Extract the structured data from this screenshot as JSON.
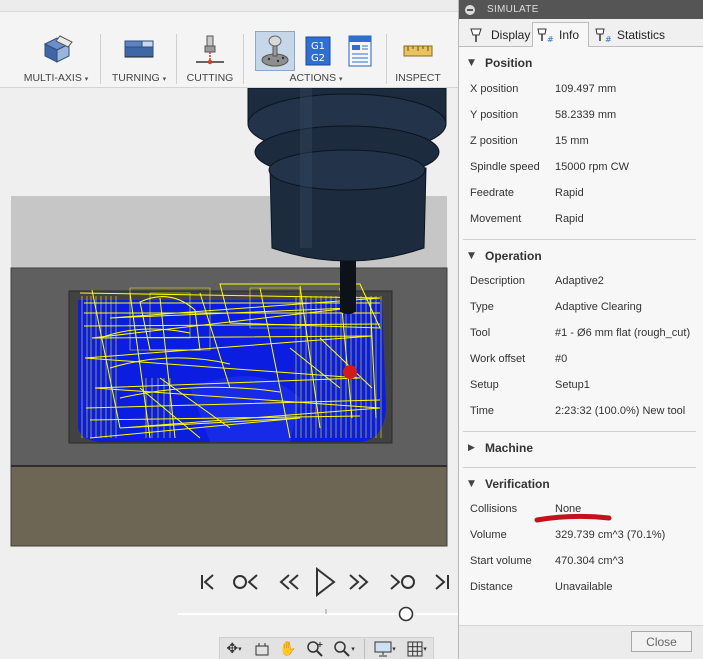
{
  "toolbar": {
    "groups": [
      {
        "label": "MULTI-AXIS",
        "has_menu": true,
        "icon": "multi-axis-icon"
      },
      {
        "label": "TURNING",
        "has_menu": true,
        "icon": "turning-icon"
      },
      {
        "label": "CUTTING",
        "has_menu": false,
        "icon": "cutting-icon"
      },
      {
        "label": "ACTIONS",
        "has_menu": true,
        "icons": [
          "simulate-icon",
          "nc-code-icon",
          "setup-sheet-icon"
        ],
        "g1": "G1",
        "g2": "G2"
      },
      {
        "label": "INSPECT",
        "has_menu": false,
        "icon": "measure-icon"
      }
    ],
    "menu_arrow": "▾"
  },
  "viewport": {
    "colors": {
      "stock_top": "#c6c6c6",
      "stock_side": "#5f5f5f",
      "material": "#0a1de0",
      "toolpath": "#ffff00",
      "tool": "#1d2b3e",
      "collision": "#d11b1b"
    }
  },
  "playback": {
    "buttons": [
      "go-to-start",
      "previous-operation",
      "step-back",
      "play",
      "step-forward",
      "next-operation",
      "go-to-end"
    ],
    "timeline_progress": 0.88
  },
  "navbar": {
    "icons": [
      "orbit-icon",
      "look-at-icon",
      "pan-icon",
      "zoom-icon",
      "zoom-window-icon",
      "display-settings-icon",
      "grid-icon"
    ]
  },
  "panel": {
    "title": "SIMULATE",
    "tabs": [
      {
        "label": "Display",
        "active": false
      },
      {
        "label": "Info",
        "active": true
      },
      {
        "label": "Statistics",
        "active": false
      }
    ],
    "sections": {
      "position": {
        "title": "Position",
        "rows": [
          {
            "label": "X position",
            "value": "109.497 mm"
          },
          {
            "label": "Y position",
            "value": "58.2339 mm"
          },
          {
            "label": "Z position",
            "value": "15 mm"
          },
          {
            "label": "Spindle speed",
            "value": "15000 rpm CW"
          },
          {
            "label": "Feedrate",
            "value": "Rapid"
          },
          {
            "label": "Movement",
            "value": "Rapid"
          }
        ]
      },
      "operation": {
        "title": "Operation",
        "rows": [
          {
            "label": "Description",
            "value": "Adaptive2"
          },
          {
            "label": "Type",
            "value": "Adaptive Clearing"
          },
          {
            "label": "Tool",
            "value": "#1 - Ø6 mm flat (rough_cut)"
          },
          {
            "label": "Work offset",
            "value": "#0"
          },
          {
            "label": "Setup",
            "value": "Setup1"
          },
          {
            "label": "Time",
            "value": "2:23:32 (100.0%) New tool"
          }
        ]
      },
      "machine": {
        "title": "Machine"
      },
      "verification": {
        "title": "Verification",
        "rows": [
          {
            "label": "Collisions",
            "value": "None"
          },
          {
            "label": "Volume",
            "value": "329.739 cm^3 (70.1%)"
          },
          {
            "label": "Start volume",
            "value": "470.304 cm^3"
          },
          {
            "label": "Distance",
            "value": "Unavailable"
          }
        ]
      }
    },
    "close_label": "Close",
    "annotation_color": "#c0141c"
  }
}
